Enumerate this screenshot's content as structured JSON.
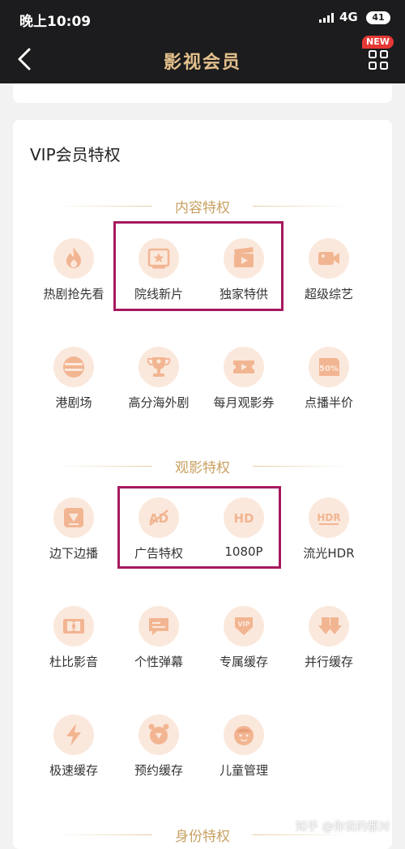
{
  "status_bar": {
    "time": "晚上10:09",
    "network": "4G",
    "battery": "41"
  },
  "nav": {
    "title": "影视会员",
    "badge": "NEW"
  },
  "card": {
    "title": "VIP会员特权"
  },
  "sections": [
    {
      "title": "内容特权",
      "items": [
        {
          "label": "热剧抢先看",
          "icon": "flame-icon"
        },
        {
          "label": "院线新片",
          "icon": "movie-poster-icon"
        },
        {
          "label": "独家特供",
          "icon": "clapperboard-icon"
        },
        {
          "label": "超级综艺",
          "icon": "video-camera-icon"
        },
        {
          "label": "港剧场",
          "icon": "hk-theater-icon"
        },
        {
          "label": "高分海外剧",
          "icon": "trophy-icon"
        },
        {
          "label": "每月观影券",
          "icon": "ticket-icon"
        },
        {
          "label": "点播半价",
          "icon": "half-price-icon"
        }
      ]
    },
    {
      "title": "观影特权",
      "items": [
        {
          "label": "边下边播",
          "icon": "download-play-icon"
        },
        {
          "label": "广告特权",
          "icon": "no-ads-icon",
          "glyph": "AD"
        },
        {
          "label": "1080P",
          "icon": "hd-icon",
          "glyph": "HD"
        },
        {
          "label": "流光HDR",
          "icon": "hdr-icon",
          "glyph": "HDR"
        },
        {
          "label": "杜比影音",
          "icon": "dolby-icon"
        },
        {
          "label": "个性弹幕",
          "icon": "danmaku-icon"
        },
        {
          "label": "专属缓存",
          "icon": "vip-cache-icon",
          "glyph": "VIP"
        },
        {
          "label": "并行缓存",
          "icon": "parallel-download-icon"
        },
        {
          "label": "极速缓存",
          "icon": "lightning-icon"
        },
        {
          "label": "预约缓存",
          "icon": "alarm-clock-icon"
        },
        {
          "label": "儿童管理",
          "icon": "child-face-icon"
        }
      ]
    },
    {
      "title": "身份特权"
    }
  ],
  "half_price_text": "50%",
  "watermark": "知乎 @你说的都对",
  "colors": {
    "accent": "#c8a163",
    "icon_bg": "#fbe8dc",
    "icon_fg": "#e8a07a",
    "highlight": "#a6195f",
    "header_bg": "#1c1c1e"
  }
}
